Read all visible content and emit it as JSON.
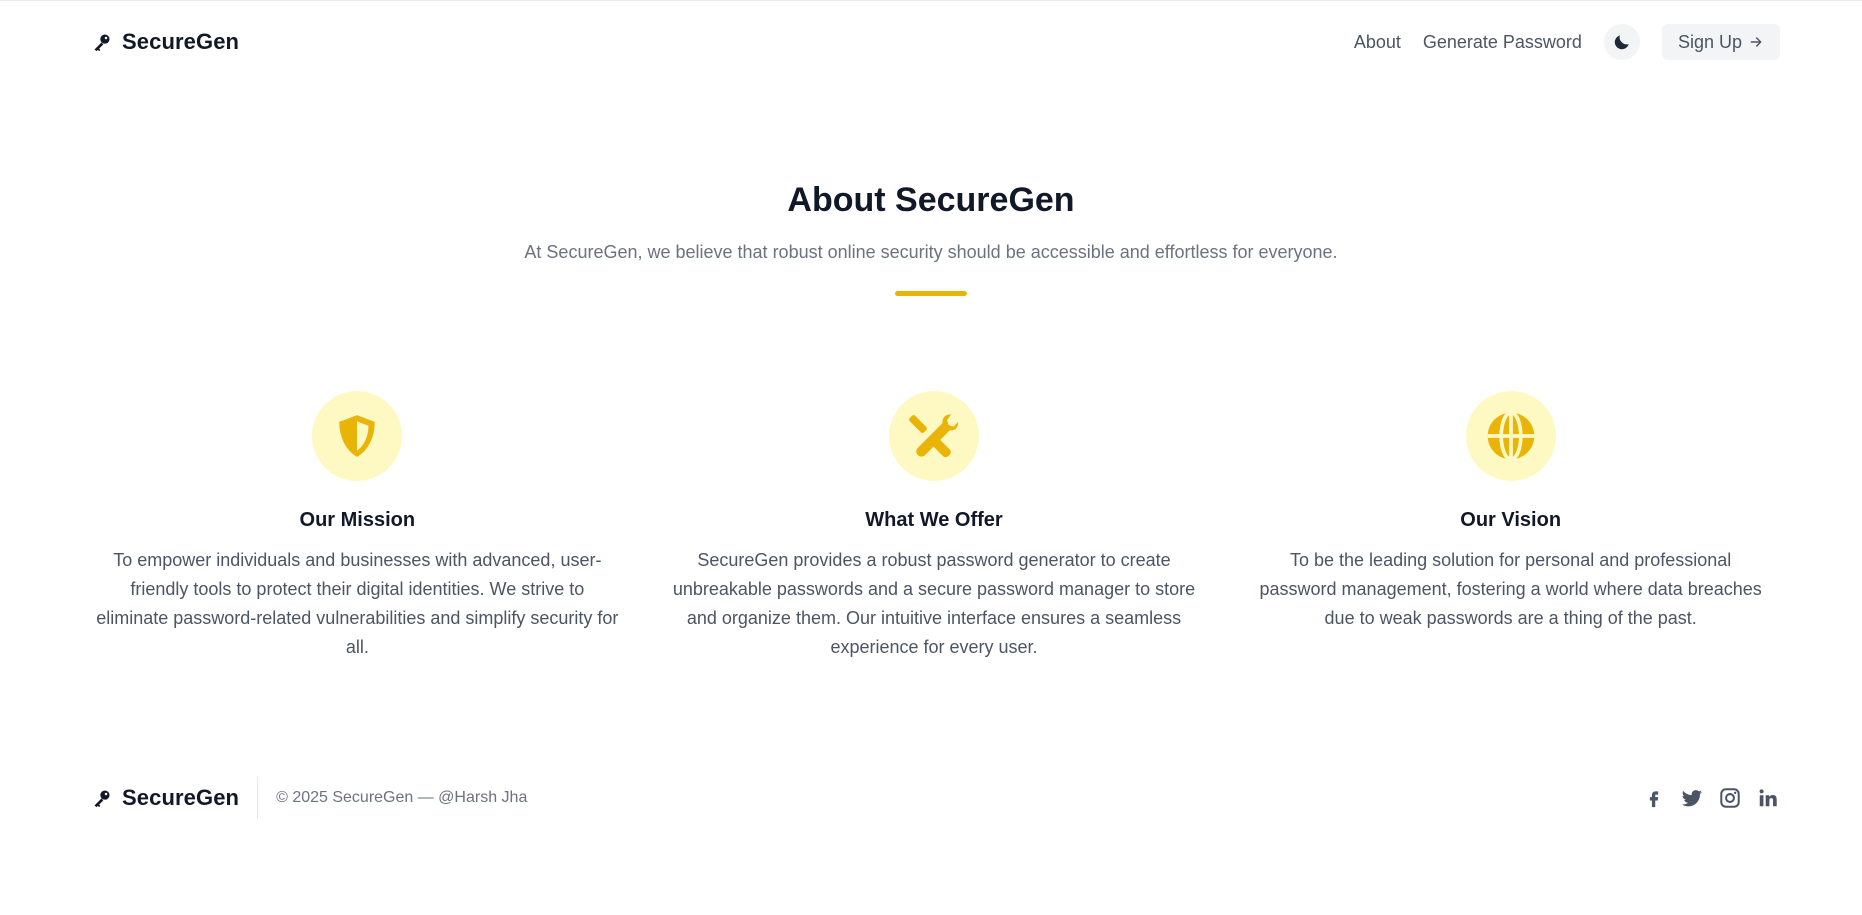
{
  "header": {
    "brand_name": "SecureGen",
    "brand_icon": "key-icon",
    "nav": {
      "about": "About",
      "generate": "Generate Password",
      "theme_icon": "moon-icon",
      "signup": "Sign Up"
    }
  },
  "hero": {
    "title": "About SecureGen",
    "subtitle": "At SecureGen, we believe that robust online security should be accessible and effortless for everyone."
  },
  "features": [
    {
      "icon": "shield-icon",
      "title": "Our Mission",
      "text": "To empower individuals and businesses with advanced, user-friendly tools to protect their digital identities. We strive to eliminate password-related vulnerabilities and simplify security for all."
    },
    {
      "icon": "tools-icon",
      "title": "What We Offer",
      "text": "SecureGen provides a robust password generator to create unbreakable passwords and a secure password manager to store and organize them. Our intuitive interface ensures a seamless experience for every user."
    },
    {
      "icon": "globe-icon",
      "title": "Our Vision",
      "text": "To be the leading solution for personal and professional password management, fostering a world where data breaches due to weak passwords are a thing of the past."
    }
  ],
  "footer": {
    "brand_name": "SecureGen",
    "copyright": "© 2025 SecureGen — @Harsh Jha",
    "socials": [
      "facebook-icon",
      "twitter-icon",
      "instagram-icon",
      "linkedin-icon"
    ]
  },
  "colors": {
    "accent": "#eab308",
    "accent_soft": "#fef9c3",
    "text_dark": "#111827",
    "text_muted": "#6b7280"
  }
}
